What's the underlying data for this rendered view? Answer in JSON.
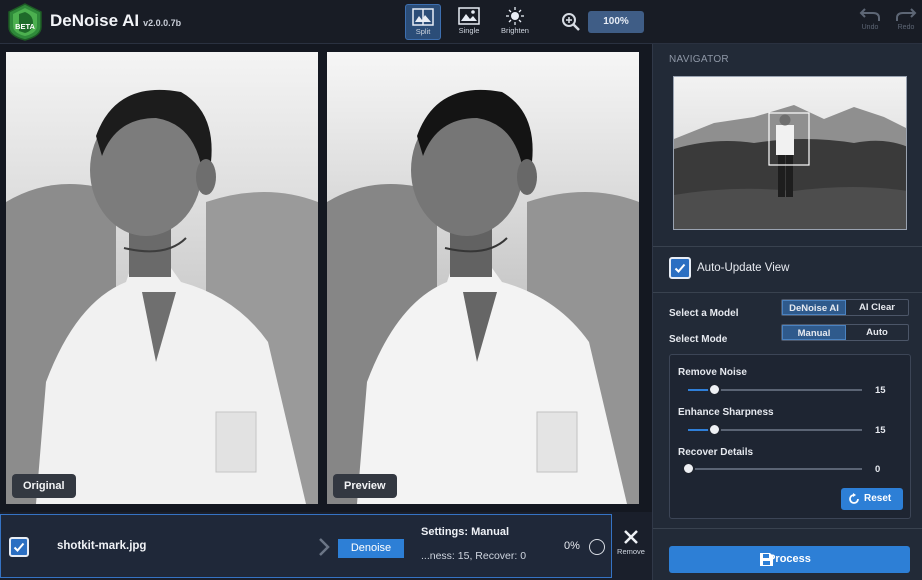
{
  "app": {
    "name": "DeNoise AI",
    "version": "v2.0.0.7b",
    "beta_badge": "BETA"
  },
  "toolbar": {
    "views": [
      {
        "label": "Split",
        "active": true
      },
      {
        "label": "Single",
        "active": false
      },
      {
        "label": "Brighten",
        "active": false
      }
    ],
    "zoom": "100%",
    "undo_label": "Undo",
    "redo_label": "Redo"
  },
  "panes": {
    "left_label": "Original",
    "right_label": "Preview"
  },
  "file_bar": {
    "checked": true,
    "file_name": "shotkit-mark.jpg",
    "action": "Denoise",
    "settings_title": "Settings: Manual",
    "settings_detail": "...ness: 15, Recover: 0",
    "progress": "0%",
    "remove_label": "Remove"
  },
  "right_panel": {
    "navigator_title": "NAVIGATOR",
    "auto_update": {
      "label": "Auto-Update View",
      "checked": true
    },
    "model": {
      "label": "Select a Model",
      "options": [
        "DeNoise AI",
        "AI Clear"
      ],
      "selected": "DeNoise AI"
    },
    "mode": {
      "label": "Select Mode",
      "options": [
        "Manual",
        "Auto"
      ],
      "selected": "Manual"
    },
    "sliders": [
      {
        "label": "Remove Noise",
        "value": "15",
        "level": 0.15
      },
      {
        "label": "Enhance Sharpness",
        "value": "15",
        "level": 0.15
      },
      {
        "label": "Recover Details",
        "value": "0",
        "level": 0.0
      }
    ],
    "reset_label": "Reset",
    "process_label": "Process"
  },
  "colors": {
    "accent": "#2d7fd6",
    "background": "#1a1f2b",
    "panel": "#222a37",
    "active_button": "#2b4d78"
  }
}
